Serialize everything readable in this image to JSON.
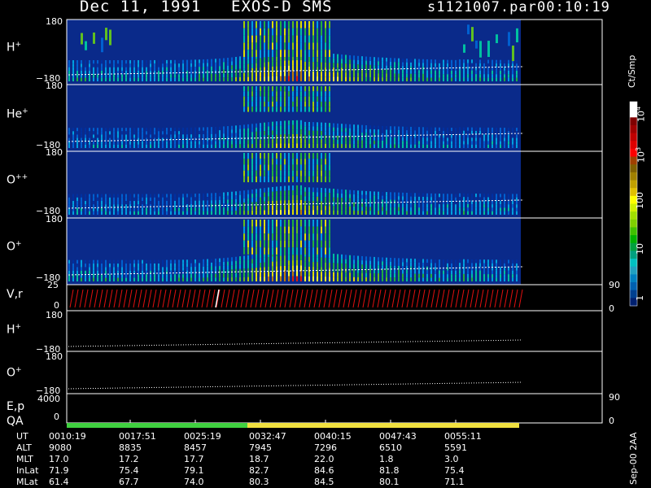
{
  "header": {
    "date": "Dec 11, 1991",
    "instrument": "EXOS-D SMS",
    "file": "s1121007.par",
    "time": "00:10:19"
  },
  "panels": [
    {
      "label": "H",
      "sup": "+",
      "top": "180",
      "bottom": "−180"
    },
    {
      "label": "He",
      "sup": "+",
      "top": "180",
      "bottom": "−180"
    },
    {
      "label": "O",
      "sup": "++",
      "top": "180",
      "bottom": "−180"
    },
    {
      "label": "O",
      "sup": "+",
      "top": "180",
      "bottom": "−180"
    }
  ],
  "vr_panel": {
    "label": "V,r",
    "top": "25",
    "bottom": "0",
    "right_top": "90",
    "right_bottom": "0"
  },
  "line_panels": [
    {
      "label": "H",
      "sup": "+",
      "top": "180",
      "bottom": "−180"
    },
    {
      "label": "O",
      "sup": "+",
      "top": "180",
      "bottom": "−180"
    }
  ],
  "ep_panel": {
    "label": "E,p",
    "top": "4000",
    "bottom": "0",
    "right_top": "90",
    "right_bottom": "0"
  },
  "qa_panel": {
    "label": "QA"
  },
  "colorbar": {
    "unit": "Ct/Smp",
    "ticks": [
      "10",
      "4",
      "10",
      "3",
      "100",
      "10",
      "1"
    ],
    "colors": [
      "#ffffff",
      "#ffffff",
      "#800000",
      "#a00000",
      "#c00000",
      "#e00000",
      "#ff0000",
      "#a04000",
      "#806000",
      "#a08000",
      "#c0a000",
      "#e0c000",
      "#ffff00",
      "#d0f000",
      "#a0e000",
      "#80d000",
      "#40c000",
      "#00b000",
      "#00a040",
      "#00a080",
      "#00c0c0",
      "#20a0c0",
      "#0080c0",
      "#0060b0",
      "#004090",
      "#002070"
    ]
  },
  "footer": {
    "rows": [
      {
        "name": "UT",
        "values": [
          "0010:19",
          "0017:51",
          "0025:19",
          "0032:47",
          "0040:15",
          "0047:43",
          "0055:11"
        ]
      },
      {
        "name": "ALT",
        "values": [
          "9080",
          "8835",
          "8457",
          "7945",
          "7296",
          "6510",
          "5591"
        ]
      },
      {
        "name": "MLT",
        "values": [
          "17.0",
          "17.2",
          "17.7",
          "18.7",
          "22.0",
          "1.8",
          "3.0"
        ]
      },
      {
        "name": "InLat",
        "values": [
          "71.9",
          "75.4",
          "79.1",
          "82.7",
          "84.6",
          "81.8",
          "75.4"
        ]
      },
      {
        "name": "MLat",
        "values": [
          "61.4",
          "67.7",
          "74.0",
          "80.3",
          "84.5",
          "80.1",
          "71.1"
        ]
      }
    ],
    "stamp": "Sep-00 2AA"
  },
  "chart_data": {
    "type": "heatmap",
    "title": "Dec 11, 1991 EXOS-D SMS",
    "panels": [
      "H+",
      "He+",
      "O++",
      "O+",
      "V,r",
      "H+",
      "O+",
      "E,p",
      "QA"
    ],
    "ylim": [
      -180,
      180
    ],
    "x_ticks": [
      "0010:19",
      "0017:51",
      "0025:19",
      "0032:47",
      "0040:15",
      "0047:43",
      "0055:11"
    ],
    "colorbar": {
      "label": "Ct/Smp",
      "scale": "log",
      "range": [
        1,
        10000
      ]
    },
    "qa_segments": [
      {
        "color": "#40d040",
        "from": "0010:19",
        "to": "0028:30"
      },
      {
        "color": "#f0e040",
        "from": "0028:30",
        "to": "0056:30"
      }
    ]
  }
}
